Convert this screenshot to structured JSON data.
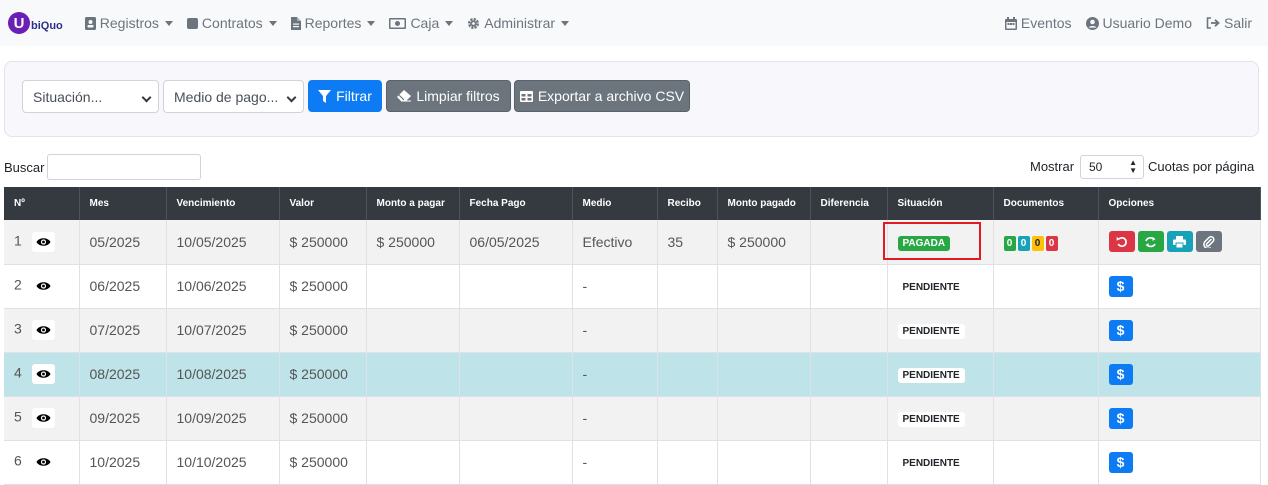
{
  "brand": {
    "letter": "U",
    "text": "biQuo"
  },
  "nav": {
    "left": [
      {
        "label": "Registros",
        "icon": "id-card-icon"
      },
      {
        "label": "Contratos",
        "icon": "square-icon"
      },
      {
        "label": "Reportes",
        "icon": "file-icon"
      },
      {
        "label": "Caja",
        "icon": "cash-icon"
      },
      {
        "label": "Administrar",
        "icon": "gear-icon"
      }
    ],
    "right": [
      {
        "label": "Eventos",
        "icon": "calendar-icon"
      },
      {
        "label": "Usuario Demo",
        "icon": "user-icon"
      },
      {
        "label": "Salir",
        "icon": "sign-out-icon"
      }
    ]
  },
  "filters": {
    "situacion": "Situación...",
    "medio": "Medio de pago...",
    "filtrar": "Filtrar",
    "limpiar": "Limpiar filtros",
    "exportar": "Exportar a archivo CSV"
  },
  "search": {
    "label": "Buscar",
    "value": ""
  },
  "paging": {
    "show_label": "Mostrar",
    "value": "50",
    "per_page": "Cuotas por página"
  },
  "table": {
    "headers": [
      "Nº",
      "Mes",
      "Vencimiento",
      "Valor",
      "Monto a pagar",
      "Fecha Pago",
      "Medio",
      "Recibo",
      "Monto pagado",
      "Diferencia",
      "Situación",
      "Documentos",
      "Opciones"
    ],
    "rows": [
      {
        "n": "1",
        "mes": "05/2025",
        "venc": "10/05/2025",
        "valor": "$ 250000",
        "monto": "$ 250000",
        "fecha": "06/05/2025",
        "medio": "Efectivo",
        "recibo": "35",
        "pagado": "$ 250000",
        "dif": "",
        "situacion": "PAGADA",
        "docs": [
          "0",
          "0",
          "0",
          "0"
        ]
      },
      {
        "n": "2",
        "mes": "06/2025",
        "venc": "10/06/2025",
        "valor": "$ 250000",
        "monto": "",
        "fecha": "",
        "medio": "-",
        "recibo": "",
        "pagado": "",
        "dif": "",
        "situacion": "PENDIENTE"
      },
      {
        "n": "3",
        "mes": "07/2025",
        "venc": "10/07/2025",
        "valor": "$ 250000",
        "monto": "",
        "fecha": "",
        "medio": "-",
        "recibo": "",
        "pagado": "",
        "dif": "",
        "situacion": "PENDIENTE"
      },
      {
        "n": "4",
        "mes": "08/2025",
        "venc": "10/08/2025",
        "valor": "$ 250000",
        "monto": "",
        "fecha": "",
        "medio": "-",
        "recibo": "",
        "pagado": "",
        "dif": "",
        "situacion": "PENDIENTE"
      },
      {
        "n": "5",
        "mes": "09/2025",
        "venc": "10/09/2025",
        "valor": "$ 250000",
        "monto": "",
        "fecha": "",
        "medio": "-",
        "recibo": "",
        "pagado": "",
        "dif": "",
        "situacion": "PENDIENTE"
      },
      {
        "n": "6",
        "mes": "10/2025",
        "venc": "10/10/2025",
        "valor": "$ 250000",
        "monto": "",
        "fecha": "",
        "medio": "-",
        "recibo": "",
        "pagado": "",
        "dif": "",
        "situacion": "PENDIENTE"
      }
    ],
    "pay_label": "$"
  },
  "colors": {
    "primary": "#0d7bf3",
    "secondary": "#6c757d",
    "success": "#28a745",
    "danger": "#dc3545",
    "info": "#17a2b8",
    "warning": "#ffc107",
    "header": "#343a40",
    "highlight": "#bee3e8",
    "annotation": "#e01b24"
  }
}
